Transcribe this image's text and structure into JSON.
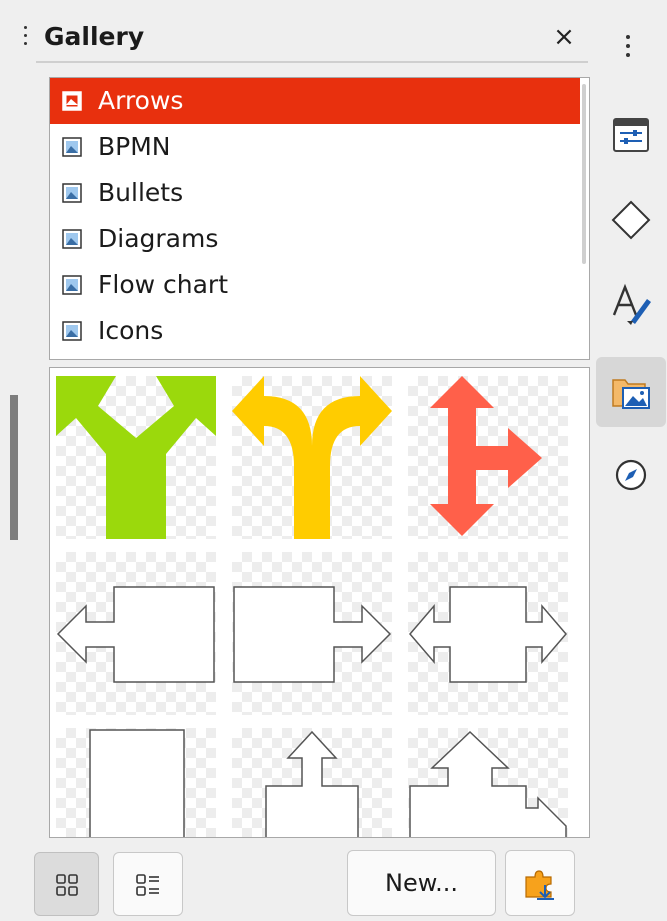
{
  "gallery": {
    "title": "Gallery",
    "close_glyph": "×",
    "themes": [
      {
        "label": "Arrows",
        "selected": true
      },
      {
        "label": "BPMN",
        "selected": false
      },
      {
        "label": "Bullets",
        "selected": false
      },
      {
        "label": "Diagrams",
        "selected": false
      },
      {
        "label": "Flow chart",
        "selected": false
      },
      {
        "label": "Icons",
        "selected": false
      }
    ],
    "thumbnails": [
      {
        "name": "split-arrow-green-icon",
        "color": "#9bd90c"
      },
      {
        "name": "split-arrow-yellow-icon",
        "color": "#ffcc00"
      },
      {
        "name": "three-way-arrow-red-icon",
        "color": "#ff604a"
      },
      {
        "name": "left-arrow-box-icon",
        "color": "#ffffff"
      },
      {
        "name": "right-arrow-box-icon",
        "color": "#ffffff"
      },
      {
        "name": "left-right-arrow-box-icon",
        "color": "#ffffff"
      },
      {
        "name": "plain-box-icon",
        "color": "#ffffff"
      },
      {
        "name": "up-arrow-box-icon",
        "color": "#ffffff"
      },
      {
        "name": "up-right-arrow-box-icon",
        "color": "#ffffff"
      }
    ],
    "footer": {
      "icon_view": "icon-view-icon",
      "detail_view": "detail-view-icon",
      "new_label": "New...",
      "extension_icon": "extension-icon"
    }
  },
  "sidebar_deck": {
    "menu": "more-options-icon",
    "tabs": [
      {
        "name": "properties-icon",
        "active": false
      },
      {
        "name": "shapes-icon",
        "active": false
      },
      {
        "name": "styles-icon",
        "active": false
      },
      {
        "name": "gallery-icon",
        "active": true
      },
      {
        "name": "navigator-icon",
        "active": false
      }
    ]
  },
  "accent_color": "#e8300e"
}
